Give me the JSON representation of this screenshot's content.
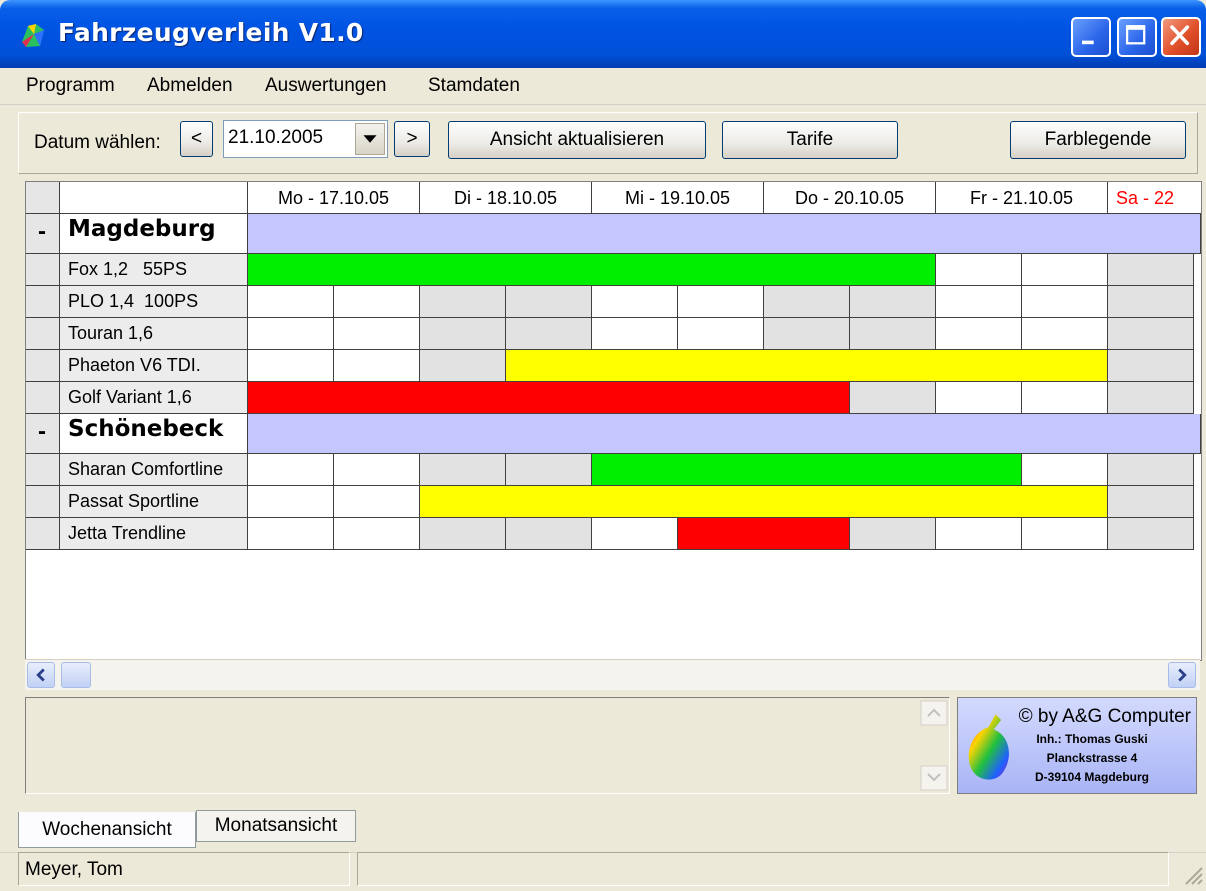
{
  "window": {
    "title": "Fahrzeugverleih V1.0"
  },
  "menu": [
    "Programm",
    "Abmelden",
    "Auswertungen",
    "Stamdaten"
  ],
  "toolbar": {
    "date_label": "Datum wählen:",
    "prev_label": "<",
    "next_label": ">",
    "date_value": "21.10.2005",
    "refresh_label": "Ansicht aktualisieren",
    "tariffs_label": "Tarife",
    "legend_label": "Farblegende"
  },
  "days": [
    "Mo - 17.10.05",
    "Di - 18.10.05",
    "Mi - 19.10.05",
    "Do - 20.10.05",
    "Fr - 21.10.05",
    "Sa - 22"
  ],
  "colors": {
    "green": "#00ee00",
    "yellow": "#ffff00",
    "red": "#ff0000",
    "white": "#ffffff",
    "gray": "#e2e2e2",
    "group": "#c6c6ff",
    "weekend_text": "#ff0000"
  },
  "groups": [
    {
      "name": "Magdeburg",
      "toggle": "-",
      "vehicles": [
        {
          "name": "Fox 1,2   55PS",
          "cells": [
            "green",
            "green",
            "green",
            "green",
            "green",
            "green",
            "green",
            "green",
            "white",
            "white",
            "gray"
          ]
        },
        {
          "name": "PLO 1,4  100PS",
          "cells": [
            "white",
            "white",
            "gray",
            "gray",
            "white",
            "white",
            "gray",
            "gray",
            "white",
            "white",
            "gray"
          ]
        },
        {
          "name": "Touran 1,6",
          "cells": [
            "white",
            "white",
            "gray",
            "gray",
            "white",
            "white",
            "gray",
            "gray",
            "white",
            "white",
            "gray"
          ]
        },
        {
          "name": "Phaeton V6 TDI.",
          "cells": [
            "white",
            "white",
            "gray",
            "yellow",
            "yellow",
            "yellow",
            "yellow",
            "yellow",
            "yellow",
            "yellow",
            "gray"
          ]
        },
        {
          "name": "Golf Variant 1,6",
          "cells": [
            "red",
            "red",
            "red",
            "red",
            "red",
            "red",
            "red",
            "gray",
            "white",
            "white",
            "gray"
          ]
        }
      ]
    },
    {
      "name": "Schönebeck",
      "toggle": "-",
      "vehicles": [
        {
          "name": "Sharan Comfortline",
          "cells": [
            "white",
            "white",
            "gray",
            "gray",
            "green",
            "green",
            "green",
            "green",
            "green",
            "white",
            "gray"
          ]
        },
        {
          "name": "Passat Sportline",
          "cells": [
            "white",
            "white",
            "yellow",
            "yellow",
            "yellow",
            "yellow",
            "yellow",
            "yellow",
            "yellow",
            "yellow",
            "gray"
          ]
        },
        {
          "name": "Jetta Trendline",
          "cells": [
            "white",
            "white",
            "gray",
            "gray",
            "white",
            "red",
            "red",
            "gray",
            "white",
            "white",
            "gray"
          ]
        }
      ]
    }
  ],
  "logo": {
    "line1": "© by A&G Computer",
    "line2": "Inh.: Thomas Guski",
    "line3": "Planckstrasse 4",
    "line4": "D-39104 Magdeburg"
  },
  "tabs": [
    "Wochenansicht",
    "Monatsansicht"
  ],
  "status": {
    "user": "Meyer, Tom"
  }
}
